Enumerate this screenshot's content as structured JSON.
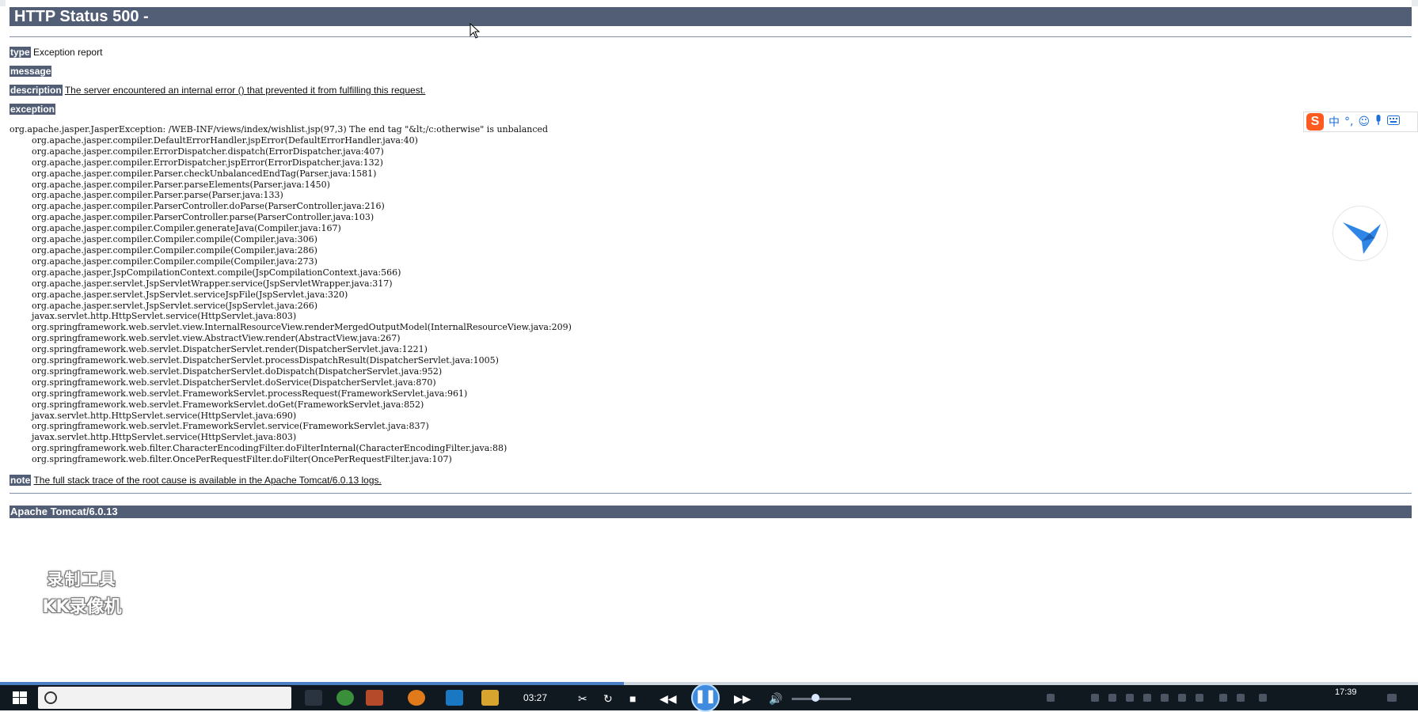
{
  "page": {
    "title": "HTTP Status 500 -",
    "type_label": "type",
    "type_value": "Exception report",
    "message_label": "message",
    "message_value": "",
    "description_label": "description",
    "description_value": "The server encountered an internal error () that prevented it from fulfilling this request.",
    "exception_label": "exception",
    "stack_trace": "org.apache.jasper.JasperException: /WEB-INF/views/index/wishlist.jsp(97,3) The end tag \"&lt;/c:otherwise\" is unbalanced\n\torg.apache.jasper.compiler.DefaultErrorHandler.jspError(DefaultErrorHandler.java:40)\n\torg.apache.jasper.compiler.ErrorDispatcher.dispatch(ErrorDispatcher.java:407)\n\torg.apache.jasper.compiler.ErrorDispatcher.jspError(ErrorDispatcher.java:132)\n\torg.apache.jasper.compiler.Parser.checkUnbalancedEndTag(Parser.java:1581)\n\torg.apache.jasper.compiler.Parser.parseElements(Parser.java:1450)\n\torg.apache.jasper.compiler.Parser.parse(Parser.java:133)\n\torg.apache.jasper.compiler.ParserController.doParse(ParserController.java:216)\n\torg.apache.jasper.compiler.ParserController.parse(ParserController.java:103)\n\torg.apache.jasper.compiler.Compiler.generateJava(Compiler.java:167)\n\torg.apache.jasper.compiler.Compiler.compile(Compiler.java:306)\n\torg.apache.jasper.compiler.Compiler.compile(Compiler.java:286)\n\torg.apache.jasper.compiler.Compiler.compile(Compiler.java:273)\n\torg.apache.jasper.JspCompilationContext.compile(JspCompilationContext.java:566)\n\torg.apache.jasper.servlet.JspServletWrapper.service(JspServletWrapper.java:317)\n\torg.apache.jasper.servlet.JspServlet.serviceJspFile(JspServlet.java:320)\n\torg.apache.jasper.servlet.JspServlet.service(JspServlet.java:266)\n\tjavax.servlet.http.HttpServlet.service(HttpServlet.java:803)\n\torg.springframework.web.servlet.view.InternalResourceView.renderMergedOutputModel(InternalResourceView.java:209)\n\torg.springframework.web.servlet.view.AbstractView.render(AbstractView.java:267)\n\torg.springframework.web.servlet.DispatcherServlet.render(DispatcherServlet.java:1221)\n\torg.springframework.web.servlet.DispatcherServlet.processDispatchResult(DispatcherServlet.java:1005)\n\torg.springframework.web.servlet.DispatcherServlet.doDispatch(DispatcherServlet.java:952)\n\torg.springframework.web.servlet.DispatcherServlet.doService(DispatcherServlet.java:870)\n\torg.springframework.web.servlet.FrameworkServlet.processRequest(FrameworkServlet.java:961)\n\torg.springframework.web.servlet.FrameworkServlet.doGet(FrameworkServlet.java:852)\n\tjavax.servlet.http.HttpServlet.service(HttpServlet.java:690)\n\torg.springframework.web.servlet.FrameworkServlet.service(FrameworkServlet.java:837)\n\tjavax.servlet.http.HttpServlet.service(HttpServlet.java:803)\n\torg.springframework.web.filter.CharacterEncodingFilter.doFilterInternal(CharacterEncodingFilter.java:88)\n\torg.springframework.web.filter.OncePerRequestFilter.doFilter(OncePerRequestFilter.java:107)",
    "note_label": "note",
    "note_value": "The full stack trace of the root cause is available in the Apache Tomcat/6.0.13 logs.",
    "footer": "Apache Tomcat/6.0.13"
  },
  "overlays": {
    "watermark_line1": "录制工具",
    "watermark_line2": "KK录像机",
    "ime_bar": {
      "logo": "S",
      "items": [
        "中",
        "°,",
        "☺",
        "mic-icon",
        "keyboard-icon"
      ],
      "chinese_label": "中",
      "punct_label": "°,"
    },
    "bird_icon": "bird-icon"
  },
  "media_player": {
    "time": "03:27",
    "progress_fraction": 0.44,
    "volume_fraction": 0.4
  },
  "taskbar": {
    "clock": "17:39",
    "search_icon": "search-icon",
    "start_icon": "windows-start-icon"
  },
  "colors": {
    "tomcat_header": "#525d76",
    "taskbar": "#101820",
    "player_accent": "#3f8be0"
  }
}
